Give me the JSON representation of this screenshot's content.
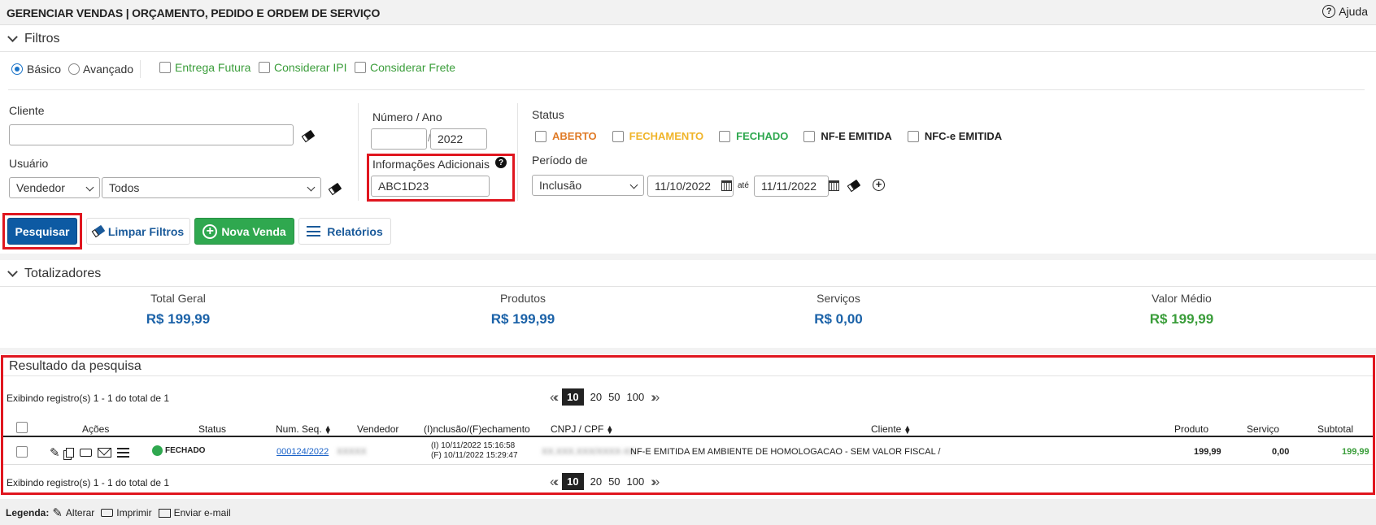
{
  "header": {
    "title": "GERENCIAR VENDAS | ORÇAMENTO, PEDIDO E ORDEM DE SERVIÇO",
    "help_label": "Ajuda"
  },
  "filters": {
    "section_title": "Filtros",
    "mode_basic": "Básico",
    "mode_advanced": "Avançado",
    "entrega_futura": "Entrega Futura",
    "considerar_ipi": "Considerar IPI",
    "considerar_frete": "Considerar Frete",
    "cliente_label": "Cliente",
    "cliente_value": "",
    "usuario_label": "Usuário",
    "usuario_type": "Vendedor",
    "usuario_value": "Todos",
    "numero_ano_label": "Número / Ano",
    "numero_value": "",
    "ano_value": "2022",
    "info_adicionais_label": "Informações Adicionais",
    "info_adicionais_value": "ABC1D23",
    "status_label": "Status",
    "status_options": [
      "ABERTO",
      "FECHAMENTO",
      "FECHADO",
      "NF-E EMITIDA",
      "NFC-e EMITIDA"
    ],
    "periodo_label": "Período de",
    "periodo_type": "Inclusão",
    "date_from": "11/10/2022",
    "ate_label": "até",
    "date_to": "11/11/2022"
  },
  "actions": {
    "pesquisar": "Pesquisar",
    "limpar": "Limpar Filtros",
    "nova_venda": "Nova Venda",
    "relatorios": "Relatórios"
  },
  "totals": {
    "section_title": "Totalizadores",
    "items": [
      {
        "label": "Total Geral",
        "value": "R$ 199,99"
      },
      {
        "label": "Produtos",
        "value": "R$ 199,99"
      },
      {
        "label": "Serviços",
        "value": "R$ 0,00"
      },
      {
        "label": "Valor Médio",
        "value": "R$ 199,99"
      }
    ]
  },
  "results": {
    "section_title": "Resultado da pesquisa",
    "showing": "Exibindo registro(s) 1 - 1 do total de 1",
    "page_sizes": [
      "10",
      "20",
      "50",
      "100"
    ],
    "columns": [
      "Ações",
      "Status",
      "Num. Seq.",
      "Vendedor",
      "(I)nclusão/(F)echamento",
      "CNPJ / CPF",
      "Cliente",
      "Produto",
      "Serviço",
      "Subtotal"
    ],
    "rows": [
      {
        "status": "FECHADO",
        "num_seq": "000124/2022",
        "vendedor": "XXXXX",
        "inclusao": "(I) 10/11/2022 15:16:58",
        "fechamento": "(F) 10/11/2022 15:29:47",
        "cnpj": "XX.XXX.XXX/XXXX-XX",
        "cliente": "NF-E EMITIDA EM AMBIENTE DE HOMOLOGACAO - SEM VALOR FISCAL /",
        "produto": "199,99",
        "servico": "0,00",
        "subtotal": "199,99"
      }
    ]
  },
  "legend": {
    "title": "Legenda:",
    "alterar": "Alterar",
    "imprimir": "Imprimir",
    "enviar": "Enviar e-mail"
  },
  "colors": {
    "primary": "#0d5aa3",
    "success": "#2fa84f",
    "highlight": "#e0161f",
    "aberto": "#e07b27",
    "fechamento": "#f0b429"
  }
}
